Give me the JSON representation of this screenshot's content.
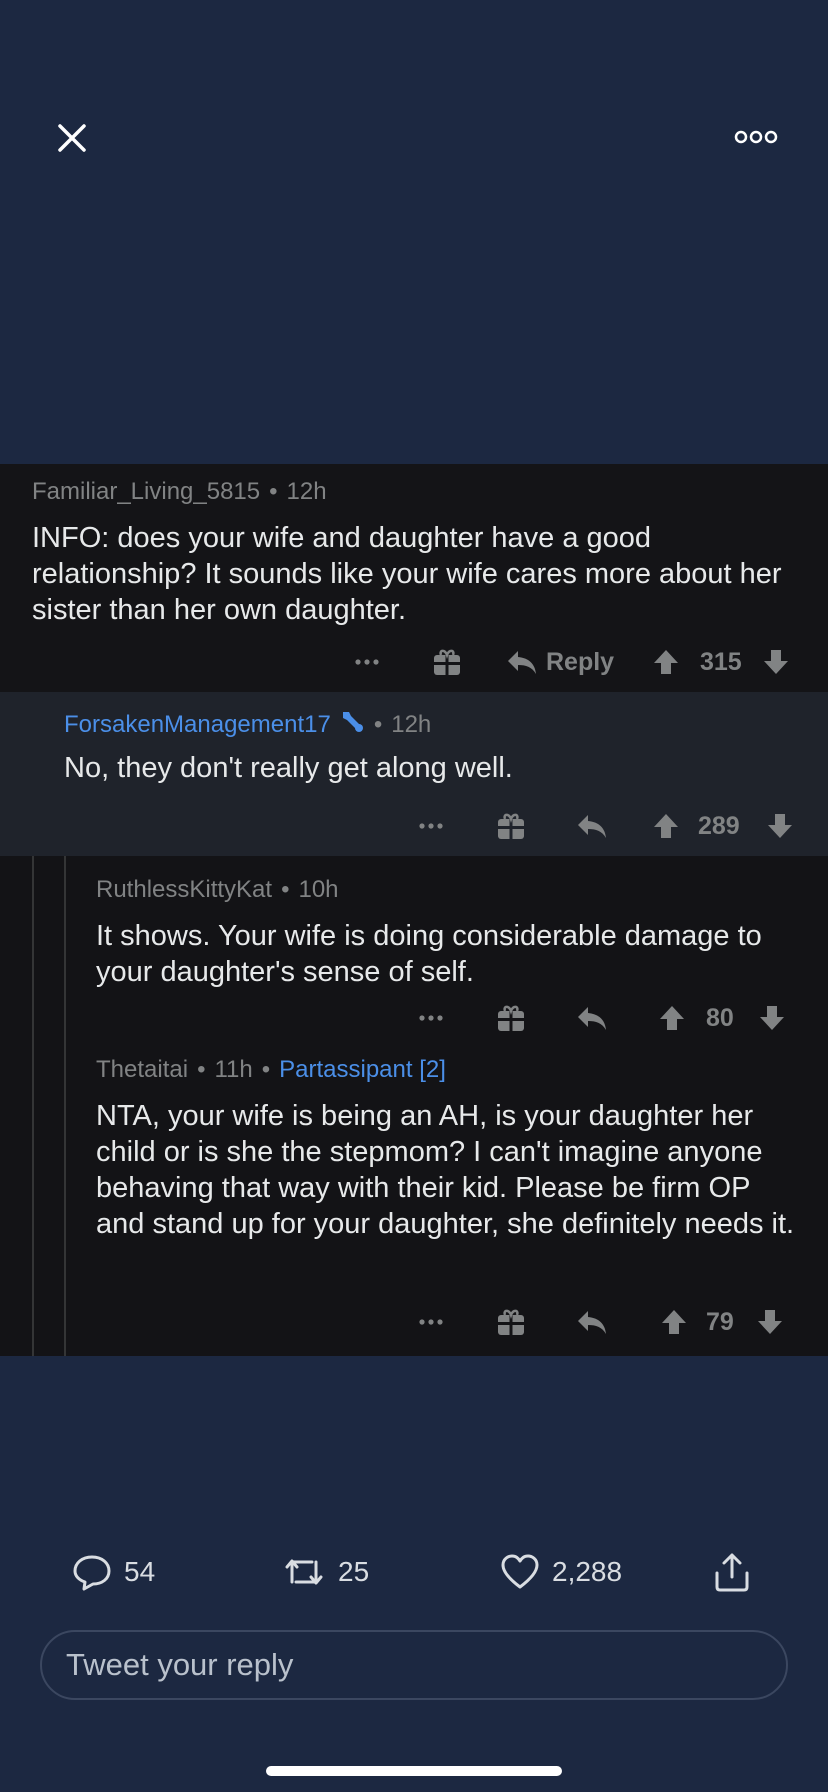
{
  "topbar": {
    "close_icon": "close-icon",
    "more_icon": "more-options-icon"
  },
  "comments": [
    {
      "user": "Familiar_Living_5815",
      "time": "12h",
      "text": "INFO: does your wife and daughter have a good relationship? It sounds like your wife cares more about her sister than her own daughter.",
      "reply_label": "Reply",
      "score": "315"
    },
    {
      "user": "ForsakenManagement17",
      "time": "12h",
      "text": "No, they don't really get along well.",
      "score": "289"
    },
    {
      "user": "RuthlessKittyKat",
      "time": "10h",
      "text": "It shows. Your wife is doing considerable damage to your daughter's sense of self.",
      "score": "80"
    },
    {
      "user": "Thetaitai",
      "time": "11h",
      "flair": "Partassipant [2]",
      "text": "NTA, your wife is being an AH, is your daughter her child or is she the stepmom? I can't imagine anyone behaving that way with their kid. Please be firm OP and stand up for your daughter, she definitely needs it.",
      "score": "79"
    }
  ],
  "tweet_actions": {
    "replies": "54",
    "retweets": "25",
    "likes": "2,288"
  },
  "reply_box": {
    "placeholder": "Tweet your reply"
  },
  "colors": {
    "background": "#1c2841",
    "comment_bg": "#141417",
    "highlight_bg": "#1f232b",
    "op_blue": "#4b8fe8",
    "meta_gray": "#818384"
  }
}
